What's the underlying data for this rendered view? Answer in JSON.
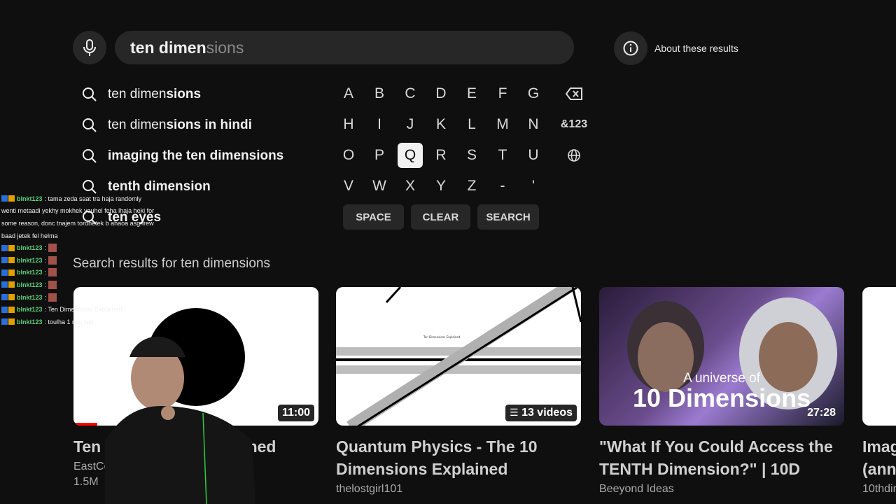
{
  "search": {
    "typed": "ten dimen",
    "completion": "sions"
  },
  "about_label": "About these results",
  "suggestions": [
    {
      "plain": "ten dimen",
      "bold": "sions"
    },
    {
      "plain": "ten dimen",
      "bold": "sions in hindi"
    },
    {
      "plain": "",
      "bold": "imaging the ten dimensions"
    },
    {
      "plain": "",
      "bold": "tenth dimension"
    },
    {
      "plain": "",
      "bold": "ten eyes"
    }
  ],
  "keyboard": {
    "row1": [
      "A",
      "B",
      "C",
      "D",
      "E",
      "F",
      "G"
    ],
    "row2": [
      "H",
      "I",
      "J",
      "K",
      "L",
      "M",
      "N"
    ],
    "row3": [
      "O",
      "P",
      "Q",
      "R",
      "S",
      "T",
      "U"
    ],
    "row4": [
      "V",
      "W",
      "X",
      "Y",
      "Z",
      "-",
      "'"
    ],
    "symbols_label": "&123",
    "selected": "Q",
    "space_label": "SPACE",
    "clear_label": "CLEAR",
    "search_label": "SEARCH"
  },
  "results_heading": "Search results for ten dimensions",
  "results": [
    {
      "title_l1": "Ten Di",
      "title_l2": "ned",
      "channel": "EastCo",
      "meta": "1.5M",
      "duration": "11:00"
    },
    {
      "title_l1": "Quantum Physics - The 10",
      "title_l2": "Dimensions Explained",
      "channel": "thelostgirl101",
      "meta": "",
      "duration": "13 videos",
      "thumb_text": "Ten Dimensions Explained"
    },
    {
      "title_l1": "\"What If You Could Access the",
      "title_l2": "TENTH Dimension?\" | 10D",
      "channel": "Beeyond Ideas",
      "meta": "",
      "duration": "27:28",
      "thumb_line1": "A universe of",
      "thumb_line2": "10 Dimensions"
    },
    {
      "title_l1": "Imag",
      "title_l2": "(ann",
      "channel": "10thdir",
      "meta": "",
      "duration": ""
    }
  ],
  "chat": [
    {
      "user": "blnkt123",
      "msg": ": tama zeda saat tra haja randomly"
    },
    {
      "user": "",
      "msg": "wenti metaadi yekhy mokhek youhel feha lhaja heki for"
    },
    {
      "user": "",
      "msg": "some reason, donc tnajem tordhetek b ahaoa asgrirew"
    },
    {
      "user": "",
      "msg": "baad jetek fel helma"
    },
    {
      "user": "blnkt123",
      "msg": ":"
    },
    {
      "user": "blnkt123",
      "msg": ":"
    },
    {
      "user": "blnkt123",
      "msg": ":"
    },
    {
      "user": "blnkt123",
      "msg": ":"
    },
    {
      "user": "blnkt123",
      "msg": ":"
    },
    {
      "user": "blnkt123",
      "msg": ": Ten Dimensions Explained"
    },
    {
      "user": "blnkt123",
      "msg": ": toulha 1 min lvid"
    }
  ],
  "colors": {
    "background": "#0f0f0f",
    "surface": "#272727",
    "chat_user": "#5ad17b",
    "progress": "#ff0000"
  }
}
